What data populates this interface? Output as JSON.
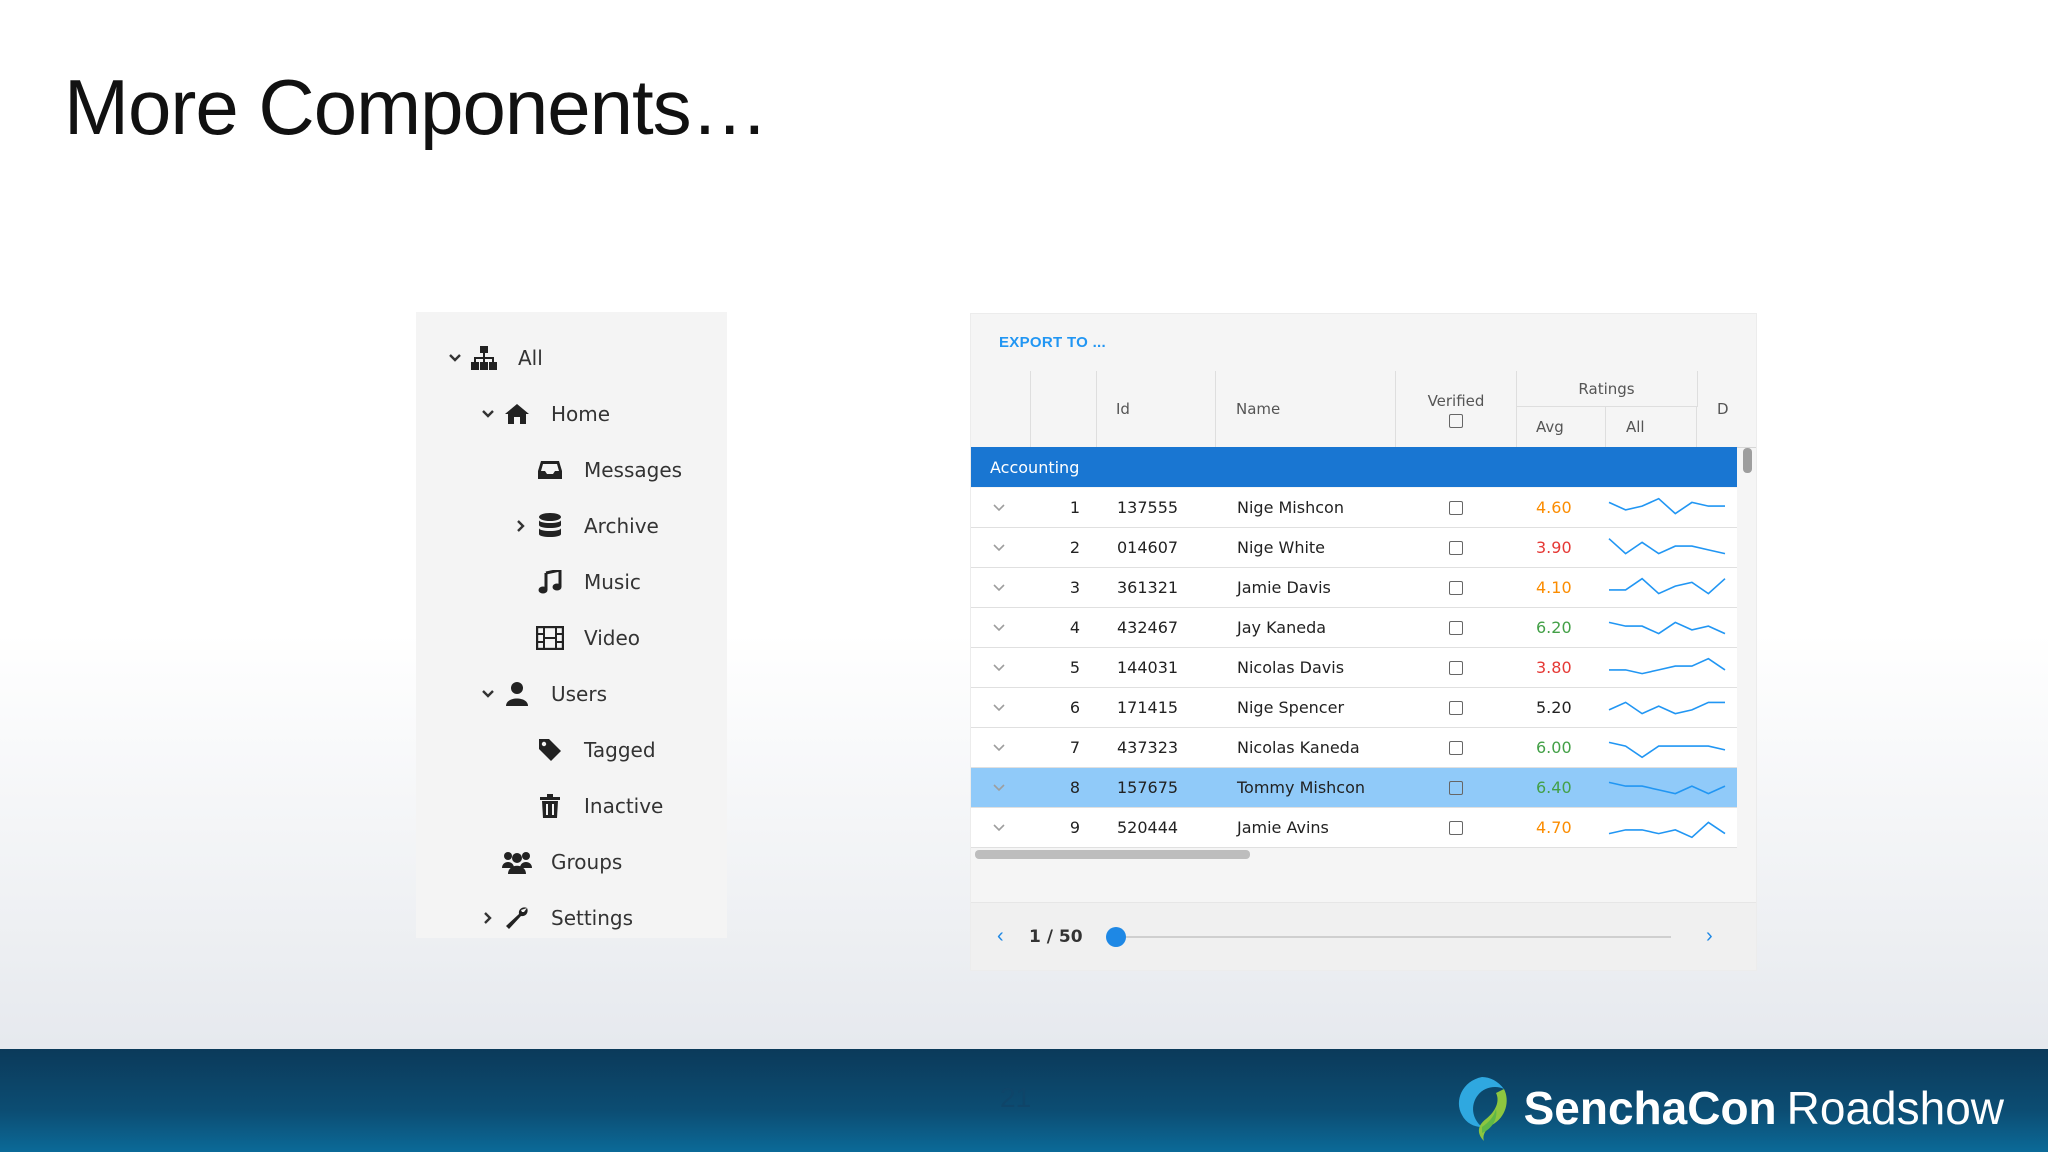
{
  "slide": {
    "title": "More Components…",
    "page_number": "21"
  },
  "tree": {
    "items": [
      {
        "label": "All",
        "icon": "sitemap-icon",
        "expanded": true
      },
      {
        "label": "Home",
        "icon": "home-icon",
        "expanded": true
      },
      {
        "label": "Messages",
        "icon": "inbox-icon"
      },
      {
        "label": "Archive",
        "icon": "database-icon",
        "expanded": false
      },
      {
        "label": "Music",
        "icon": "music-icon"
      },
      {
        "label": "Video",
        "icon": "film-icon"
      },
      {
        "label": "Users",
        "icon": "user-icon",
        "expanded": true
      },
      {
        "label": "Tagged",
        "icon": "tag-icon"
      },
      {
        "label": "Inactive",
        "icon": "trash-icon"
      },
      {
        "label": "Groups",
        "icon": "users-icon"
      },
      {
        "label": "Settings",
        "icon": "wrench-icon",
        "expanded": false
      }
    ]
  },
  "grid": {
    "export_label": "EXPORT TO ...",
    "columns": {
      "id": "Id",
      "name": "Name",
      "verified": "Verified",
      "ratings": "Ratings",
      "avg": "Avg",
      "all": "All",
      "d": "D"
    },
    "group": "Accounting",
    "colors": {
      "high": "#43a047",
      "mid": "#fb8c00",
      "low": "#e53935",
      "normal": "#222222",
      "sparkline": "#2196f3"
    },
    "rows": [
      {
        "num": "1",
        "id": "137555",
        "name": "Nige Mishcon",
        "avg": "4.60",
        "level": "mid",
        "spark": [
          5,
          3,
          4,
          6,
          2,
          5,
          4,
          4
        ],
        "selected": false
      },
      {
        "num": "2",
        "id": "014607",
        "name": "Nige White",
        "avg": "3.90",
        "level": "low",
        "spark": [
          6,
          2,
          5,
          2,
          4,
          4,
          3,
          2
        ],
        "selected": false
      },
      {
        "num": "3",
        "id": "361321",
        "name": "Jamie Davis",
        "avg": "4.10",
        "level": "mid",
        "spark": [
          3,
          3,
          6,
          2,
          4,
          5,
          2,
          6
        ],
        "selected": false
      },
      {
        "num": "4",
        "id": "432467",
        "name": "Jay Kaneda",
        "avg": "6.20",
        "level": "high",
        "spark": [
          5,
          4,
          4,
          2,
          5,
          3,
          4,
          2
        ],
        "selected": false
      },
      {
        "num": "5",
        "id": "144031",
        "name": "Nicolas Davis",
        "avg": "3.80",
        "level": "low",
        "spark": [
          3,
          3,
          2,
          3,
          4,
          4,
          6,
          3
        ],
        "selected": false
      },
      {
        "num": "6",
        "id": "171415",
        "name": "Nige Spencer",
        "avg": "5.20",
        "level": "normal",
        "spark": [
          3,
          5,
          2,
          4,
          2,
          3,
          5,
          5
        ],
        "selected": false
      },
      {
        "num": "7",
        "id": "437323",
        "name": "Nicolas Kaneda",
        "avg": "6.00",
        "level": "high",
        "spark": [
          5,
          4,
          1,
          4,
          4,
          4,
          4,
          3
        ],
        "selected": false
      },
      {
        "num": "8",
        "id": "157675",
        "name": "Tommy Mishcon",
        "avg": "6.40",
        "level": "high",
        "spark": [
          5,
          4,
          4,
          3,
          2,
          4,
          2,
          4
        ],
        "selected": true
      },
      {
        "num": "9",
        "id": "520444",
        "name": "Jamie Avins",
        "avg": "4.70",
        "level": "mid",
        "spark": [
          2,
          3,
          3,
          2,
          3,
          1,
          5,
          2
        ],
        "selected": false
      }
    ],
    "pager": {
      "text": "1 / 50",
      "prev": "‹",
      "next": "›"
    }
  },
  "footer": {
    "brand_bold": "SenchaCon",
    "brand_light": "Roadshow"
  }
}
